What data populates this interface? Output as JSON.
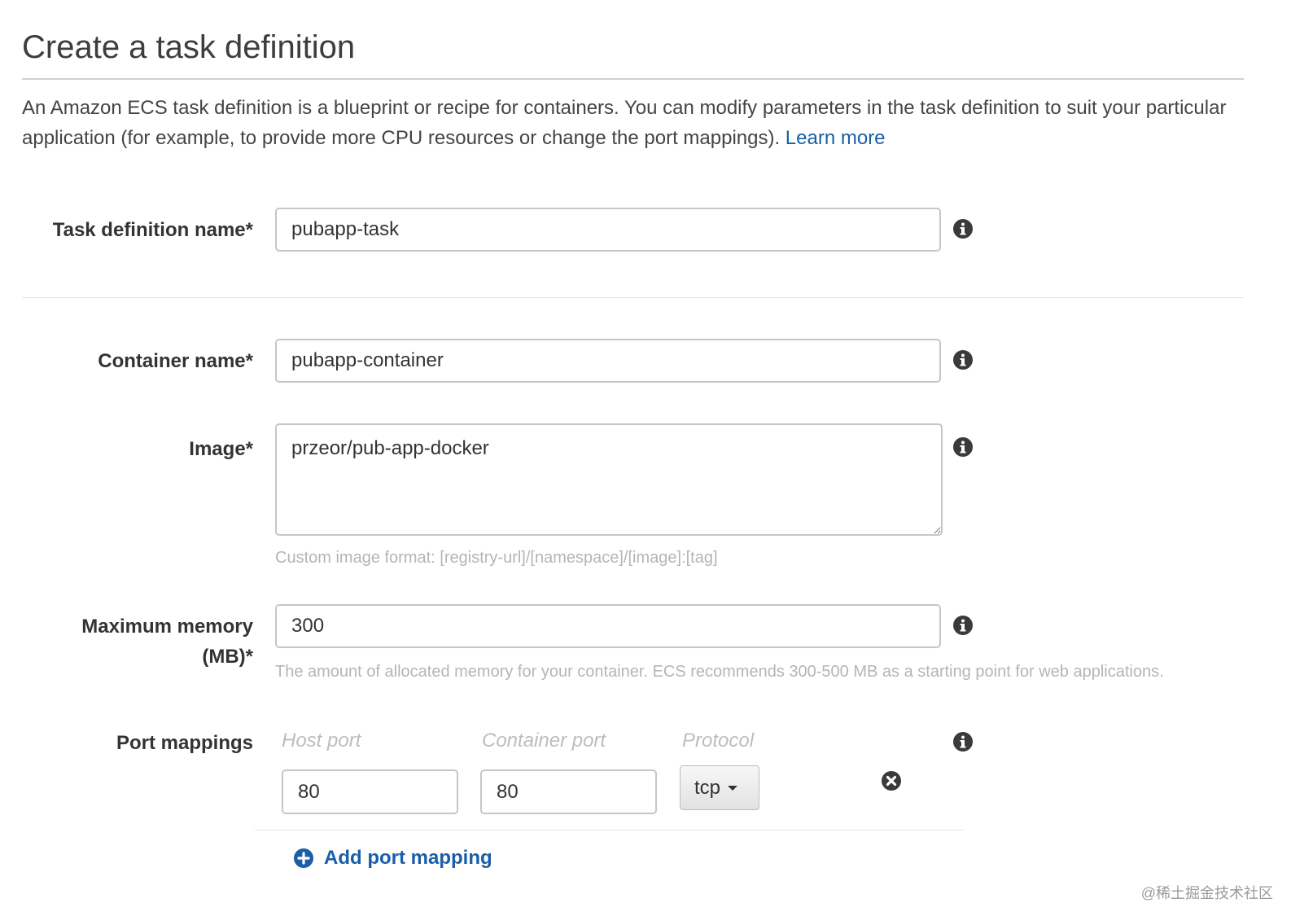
{
  "page": {
    "title": "Create a task definition",
    "intro": "An Amazon ECS task definition is a blueprint or recipe for containers. You can modify parameters in the task definition to suit your particular application (for example, to provide more CPU resources or change the port mappings).",
    "learn_more": "Learn more"
  },
  "fields": {
    "task_definition_name": {
      "label": "Task definition name*",
      "value": "pubapp-task"
    },
    "container_name": {
      "label": "Container name*",
      "value": "pubapp-container"
    },
    "image": {
      "label": "Image*",
      "value": "przeor/pub-app-docker",
      "help": "Custom image format: [registry-url]/[namespace]/[image]:[tag]"
    },
    "max_memory": {
      "label_line1": "Maximum memory",
      "label_line2": "(MB)*",
      "value": "300",
      "help": "The amount of allocated memory for your container. ECS recommends 300-500 MB as a starting point for web applications."
    }
  },
  "port_mappings": {
    "label": "Port mappings",
    "headers": {
      "host_port": "Host port",
      "container_port": "Container port",
      "protocol": "Protocol"
    },
    "rows": [
      {
        "host_port": "80",
        "container_port": "80",
        "protocol": "tcp"
      }
    ],
    "add_label": "Add port mapping"
  },
  "watermark": "@稀土掘金技术社区",
  "colors": {
    "link": "#1a5ea8",
    "icon": "#3a3a3a",
    "border": "#c6c6c6",
    "help_text": "#b5b5b5"
  },
  "icons": {
    "info": "info-icon",
    "remove": "remove-circle-icon",
    "add": "plus-circle-icon",
    "caret": "caret-down-icon"
  }
}
